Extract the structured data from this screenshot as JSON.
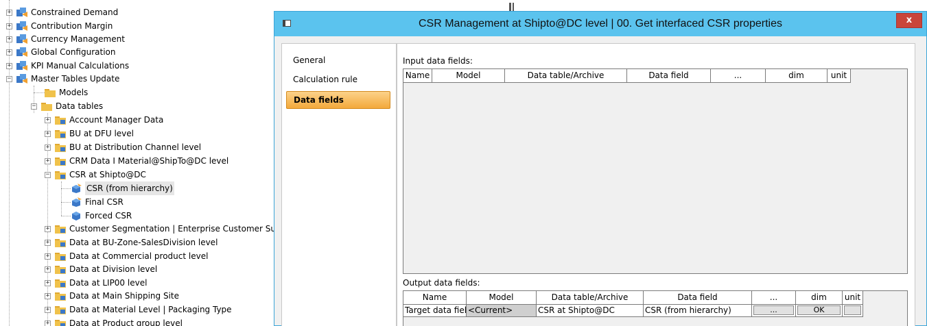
{
  "tree": {
    "items": [
      {
        "label": "Constrained Demand"
      },
      {
        "label": "Contribution Margin"
      },
      {
        "label": "Currency Management"
      },
      {
        "label": "Global Configuration"
      },
      {
        "label": "KPI Manual Calculations"
      },
      {
        "label": "Master Tables Update"
      },
      {
        "label": "Models"
      },
      {
        "label": "Data tables"
      },
      {
        "label": "Account Manager Data"
      },
      {
        "label": "BU at DFU level"
      },
      {
        "label": "BU at Distribution Channel level"
      },
      {
        "label": "CRM Data I Material@ShipTo@DC level"
      },
      {
        "label": "CSR at Shipto@DC"
      },
      {
        "label": "CSR (from hierarchy)"
      },
      {
        "label": "Final CSR"
      },
      {
        "label": "Forced CSR"
      },
      {
        "label": "Customer Segmentation | Enterprise Customer Sub"
      },
      {
        "label": "Data at BU-Zone-SalesDivision level"
      },
      {
        "label": "Data at Commercial product level"
      },
      {
        "label": "Data at Division level"
      },
      {
        "label": "Data at LIP00 level"
      },
      {
        "label": "Data at Main Shipping Site"
      },
      {
        "label": "Data at Material Level | Packaging Type"
      },
      {
        "label": "Data at Product group level"
      }
    ]
  },
  "dialog": {
    "title": "CSR Management at Shipto@DC level | 00. Get interfaced CSR properties",
    "close_label": "x",
    "nav": [
      {
        "label": "General"
      },
      {
        "label": "Calculation rule"
      },
      {
        "label": "Data fields"
      }
    ],
    "input_label": "Input data fields:",
    "input_columns": [
      "Name",
      "Model",
      "Data table/Archive",
      "Data field",
      "...",
      "dim",
      "unit"
    ],
    "output_label": "Output data fields:",
    "output_columns": [
      "Name",
      "Model",
      "Data table/Archive",
      "Data field",
      "...",
      "dim",
      "unit"
    ],
    "output_row": {
      "name": "Target data fiel",
      "model": "<Current>",
      "table": "CSR at Shipto@DC",
      "field": "CSR (from hierarchy)",
      "dots": "...",
      "dim": "OK",
      "unit": ""
    }
  },
  "colors": {
    "titlebar": "#5bc3ee",
    "close": "#c9453a",
    "nav_active": "#f3a93b",
    "folder": "#f0c24b",
    "cube": "#3b78c8"
  }
}
